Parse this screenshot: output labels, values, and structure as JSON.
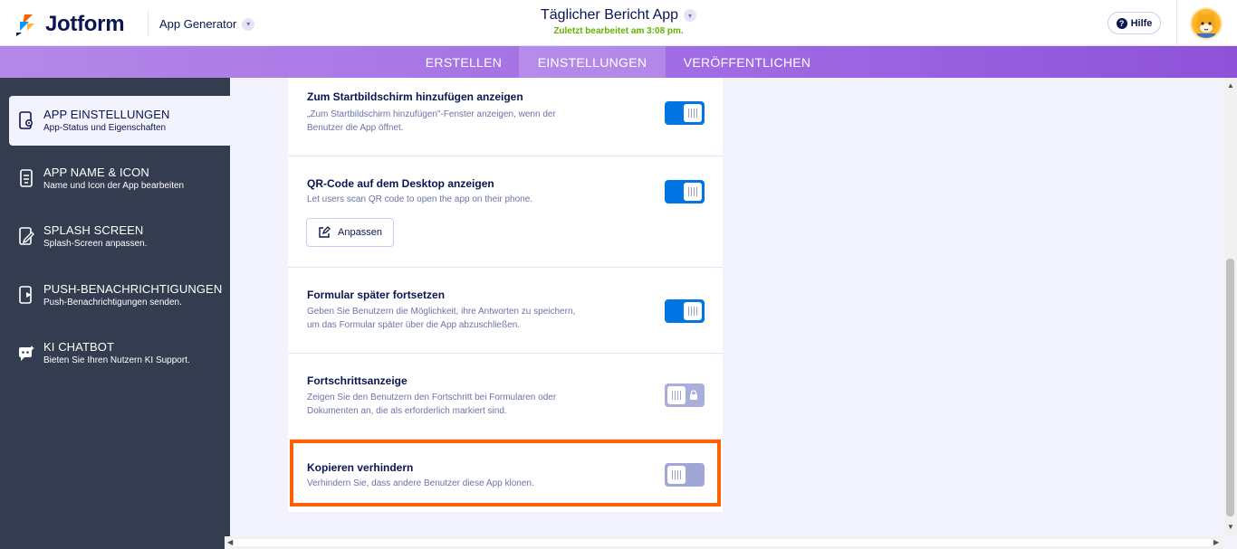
{
  "header": {
    "brand": "Jotform",
    "app_generator_label": "App Generator",
    "app_title": "Täglicher Bericht App",
    "last_edited": "Zuletzt bearbeitet am 3:08 pm.",
    "help_label": "Hilfe"
  },
  "tabs": [
    {
      "label": "ERSTELLEN",
      "active": false
    },
    {
      "label": "EINSTELLUNGEN",
      "active": true
    },
    {
      "label": "VERÖFFENTLICHEN",
      "active": false
    }
  ],
  "sidebar": {
    "items": [
      {
        "title": "APP EINSTELLUNGEN",
        "subtitle": "App-Status und Eigenschaften",
        "icon": "app-settings-icon",
        "active": true
      },
      {
        "title": "APP NAME & ICON",
        "subtitle": "Name und Icon der App bearbeiten",
        "icon": "app-name-icon",
        "active": false
      },
      {
        "title": "SPLASH SCREEN",
        "subtitle": "Splash-Screen anpassen.",
        "icon": "splash-screen-icon",
        "active": false
      },
      {
        "title": "PUSH-BENACHRICHTIGUNGEN",
        "subtitle": "Push-Benachrichtigungen senden.",
        "icon": "push-notification-icon",
        "active": false
      },
      {
        "title": "KI CHATBOT",
        "subtitle": "Bieten Sie Ihren Nutzern KI Support.",
        "icon": "chatbot-icon",
        "active": false
      }
    ]
  },
  "settings": {
    "rows": [
      {
        "title": "Zum Startbildschirm hinzufügen anzeigen",
        "description": "„Zum Startbildschirm hinzufügen\"-Fenster anzeigen, wenn der Benutzer die App öffnet.",
        "enabled": true,
        "locked": false
      },
      {
        "title": "QR-Code auf dem Desktop anzeigen",
        "description": "Let users scan QR code to open the app on their phone.",
        "enabled": true,
        "locked": false,
        "button_label": "Anpassen"
      },
      {
        "title": "Formular später fortsetzen",
        "description": "Geben Sie Benutzern die Möglichkeit, ihre Antworten zu speichern, um das Formular später über die App abzuschließen.",
        "enabled": true,
        "locked": false
      },
      {
        "title": "Fortschrittsanzeige",
        "description": "Zeigen Sie den Benutzern den Fortschritt bei Formularen oder Dokumenten an, die als erforderlich markiert sind.",
        "enabled": false,
        "locked": true
      },
      {
        "title": "Kopieren verhindern",
        "description": "Verhindern Sie, dass andere Benutzer diese App klonen.",
        "enabled": false,
        "locked": false
      }
    ]
  },
  "colors": {
    "accent_blue": "#0075e3",
    "toggle_off": "#a0a6d6",
    "sidebar_bg": "#343c4f",
    "highlight": "#ff6100",
    "last_edited": "#64b200"
  }
}
